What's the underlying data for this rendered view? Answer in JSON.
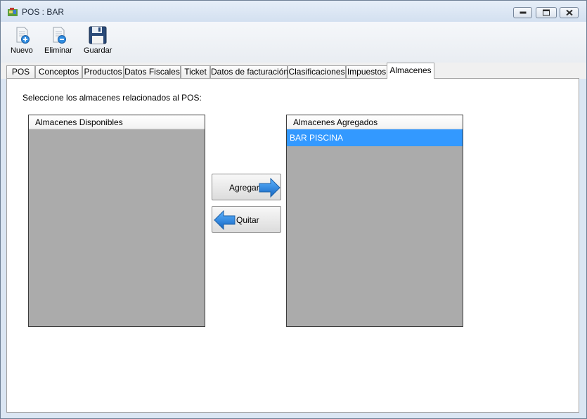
{
  "window": {
    "title": "POS : BAR",
    "icons": {
      "app": "app-map-icon",
      "minimize": "minimize-icon",
      "restore": "restore-icon",
      "close": "close-icon"
    }
  },
  "toolbar": {
    "items": [
      {
        "label": "Nuevo",
        "icon": "new-document-icon"
      },
      {
        "label": "Eliminar",
        "icon": "delete-document-icon"
      },
      {
        "label": "Guardar",
        "icon": "save-floppy-icon"
      }
    ]
  },
  "tabs": [
    {
      "label": "POS"
    },
    {
      "label": "Conceptos"
    },
    {
      "label": "Productos"
    },
    {
      "label": "Datos Fiscales"
    },
    {
      "label": "Ticket"
    },
    {
      "label": "Datos de facturación"
    },
    {
      "label": "Clasificaciones"
    },
    {
      "label": "Impuestos"
    },
    {
      "label": "Almacenes",
      "active": true
    }
  ],
  "page": {
    "instruction": "Seleccione los almacenes relacionados al POS:",
    "available": {
      "header": "Almacenes Disponibles",
      "items": []
    },
    "added": {
      "header": "Almacenes Agregados",
      "items": [
        "BAR PISCINA"
      ],
      "selected_index": 0
    },
    "add_button": {
      "label": "Agregar",
      "icon": "arrow-right-icon"
    },
    "remove_button": {
      "label": "Quitar",
      "icon": "arrow-left-icon"
    }
  },
  "colors": {
    "selection": "#3399ff",
    "list_background": "#ababab",
    "arrow": "#2a7fdc"
  }
}
